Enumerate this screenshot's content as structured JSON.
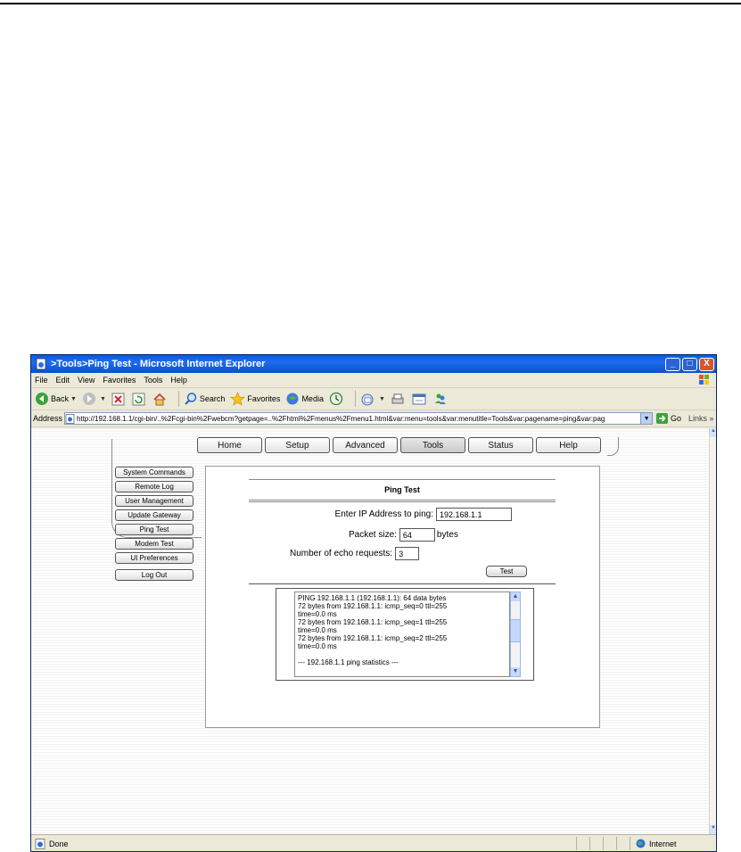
{
  "window": {
    "title": ">Tools>Ping Test - Microsoft Internet Explorer",
    "controls": {
      "minimize": "_",
      "maximize": "□",
      "close": "X"
    }
  },
  "menubar": {
    "items": [
      "File",
      "Edit",
      "View",
      "Favorites",
      "Tools",
      "Help"
    ]
  },
  "toolbar": {
    "back": "Back",
    "search": "Search",
    "favorites": "Favorites",
    "media": "Media"
  },
  "addressbar": {
    "label": "Address",
    "url": "http://192.168.1.1/cgi-bin/..%2Fcgi-bin%2Fwebcm?getpage=..%2Fhtml%2Fmenus%2Fmenu1.html&var:menu=tools&var:menutitle=Tools&var:pagename=ping&var:pag",
    "go": "Go",
    "links": "Links »"
  },
  "nav": {
    "tabs": [
      "Home",
      "Setup",
      "Advanced",
      "Tools",
      "Status",
      "Help"
    ],
    "active": "Tools"
  },
  "sidebar": {
    "items": [
      "System Commands",
      "Remote Log",
      "User Management",
      "Update Gateway",
      "Ping Test",
      "Modem Test",
      "UI Preferences"
    ],
    "logout": "Log Out"
  },
  "ping": {
    "title": "Ping Test",
    "ip_label": "Enter IP Address to ping:",
    "ip_value": "192.168.1.1",
    "size_label": "Packet size:",
    "size_value": "64",
    "size_unit": "bytes",
    "count_label": "Number of echo requests:",
    "count_value": "3",
    "test_button": "Test",
    "results": [
      "PING 192.168.1.1 (192.168.1.1): 64 data bytes",
      "72 bytes from 192.168.1.1: icmp_seq=0 ttl=255",
      "time=0.0 ms",
      "72 bytes from 192.168.1.1: icmp_seq=1 ttl=255",
      "time=0.0 ms",
      "72 bytes from 192.168.1.1: icmp_seq=2 ttl=255",
      "time=0.0 ms",
      "",
      "--- 192.168.1.1 ping statistics ---"
    ]
  },
  "statusbar": {
    "status": "Done",
    "zone": "Internet"
  }
}
